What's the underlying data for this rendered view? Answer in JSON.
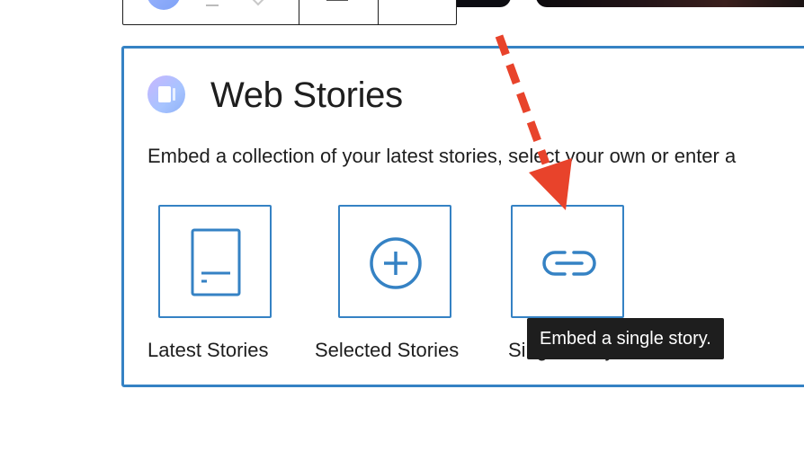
{
  "block": {
    "title": "Web Stories",
    "description": "Embed a collection of your latest stories, select your own or enter a",
    "icon": "web-stories-logo-icon"
  },
  "options": [
    {
      "label": "Latest Stories",
      "icon": "latest-stories-icon"
    },
    {
      "label": "Selected Stories",
      "icon": "plus-circle-icon"
    },
    {
      "label": "Single Story",
      "icon": "link-icon"
    }
  ],
  "tooltip": {
    "text": "Embed a single story."
  },
  "colors": {
    "accent": "#3582c4",
    "annotation_arrow": "#e8432b",
    "tooltip_bg": "#1e1e1e"
  }
}
